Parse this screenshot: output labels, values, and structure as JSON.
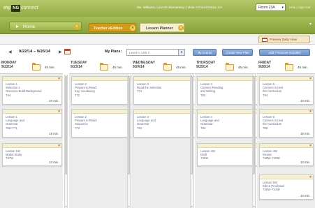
{
  "header": {
    "logo_my": "my",
    "logo_ng": "NG",
    "logo_connect": "connect",
    "user_info": "Ms. Williams  |  Lincoln Elementary  |  Vista School District, CA",
    "room": "Room 23A",
    "top_links": "Help  |  Sign Out"
  },
  "nav": {
    "home_label": "Home",
    "tabs": [
      {
        "label": "Teacher eEdition",
        "active": false
      },
      {
        "label": "Lesson Planner",
        "active": true
      }
    ],
    "overflow": "▾",
    "print_daily_view": "Preview Daily View"
  },
  "toolbar": {
    "prev": "◀",
    "date_range": "9/22/14 – 9/26/14",
    "next": "▶",
    "my_plans_label": "My Plans:",
    "my_plans_value": "Level A, Unit 2",
    "buttons": [
      "My Events",
      "Create New Plan",
      "Add / Remove Activities"
    ]
  },
  "days": [
    {
      "name": "MONDAY",
      "date": "9/22/14",
      "minutes": "45 min.",
      "cards": [
        {
          "title": "Lesson 1\nSelection 1\nOverview Build Background\nT44",
          "minutes": "20 min."
        },
        {
          "title": "Lesson 1\nLanguage and\nGrammar\nT68–T71",
          "minutes": "15 min."
        },
        {
          "title": "Lesson 1W\nModel Study\nT37W",
          "minutes": "10 min."
        }
      ]
    },
    {
      "name": "TUESDAY",
      "date": "9/23/14",
      "minutes": "45 min.",
      "cards": [
        {
          "title": "Lesson 2\nPrepare to Read:\nKey Vocabulary\nT72",
          "minutes": "15 min."
        },
        {
          "title": "Lesson 2\nPrepare to Read:\nSequence\nT73",
          "minutes": "20 min."
        }
      ]
    },
    {
      "name": "WEDNESDAY",
      "date": "9/24/14",
      "minutes": "45 min.",
      "cards": [
        {
          "title": "Lesson 3\nRead the Selection\nT74",
          "minutes": "25 min."
        },
        {
          "title": "Lesson 3\nLanguage and\nGrammar\nT81",
          "minutes": "10 min."
        }
      ]
    },
    {
      "name": "THURSDAY",
      "date": "9/25/14",
      "minutes": "45 min.",
      "cards": [
        {
          "title": "Lesson 3\nConnect Reading\nand Writing\nT82",
          "minutes": "20 min."
        },
        {
          "title": "Lesson 4\nLanguage and\nGrammar\nT83",
          "minutes": "15 min."
        },
        {
          "title": "Lesson 4W\nDraft\nT40W",
          "minutes": "15 min."
        }
      ]
    },
    {
      "name": "FRIDAY",
      "date": "9/26/14",
      "minutes": "45 min.",
      "cards": [
        {
          "title": "Lesson 5\nConnect Across\nthe Curriculum\nT84",
          "minutes": "10 min."
        },
        {
          "title": "Lesson 5\nConnect Across\nthe Curriculum\nT85",
          "minutes": "15 min."
        },
        {
          "title": "Lesson 4W\nRevise\nT38W–T39W",
          "minutes": "10 min."
        },
        {
          "title": "Lesson 5W\nEdit & Proofread\nT40W–T44W",
          "minutes": "10 min."
        }
      ]
    }
  ]
}
